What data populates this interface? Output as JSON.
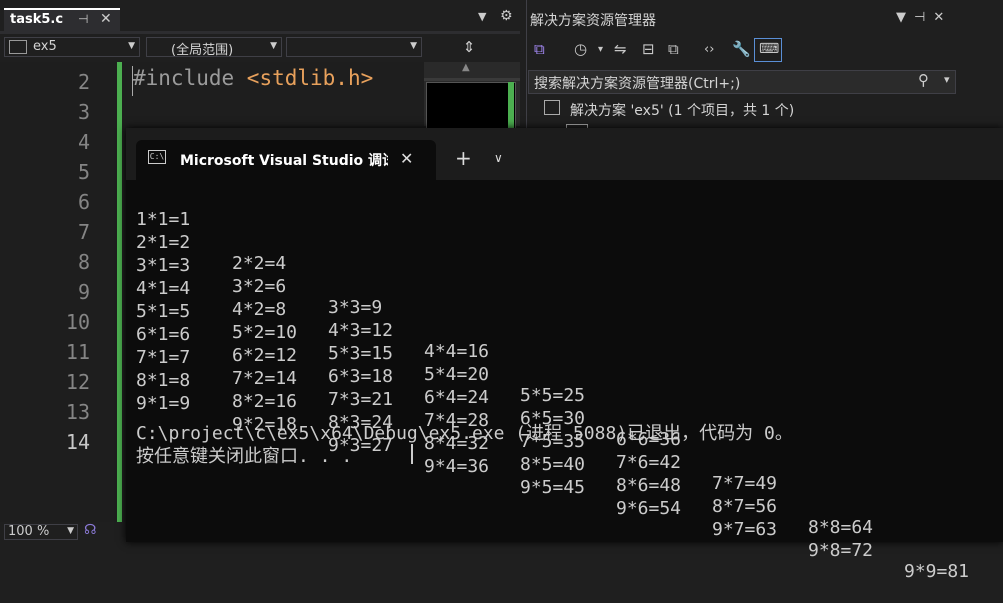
{
  "editor": {
    "tab_label": "task5.c",
    "tab_pin": "⊣",
    "tab_close": "✕",
    "tab_dropdown": "▼",
    "settings_icon": "⚙",
    "project_combo": "ex5",
    "scope_combo": "(全局范围)",
    "member_combo": "",
    "combo_arrow": "▼",
    "split_icon": "⇕",
    "line_numbers": [
      "2",
      "3",
      "4",
      "5",
      "6",
      "7",
      "8",
      "9",
      "10",
      "11",
      "12",
      "13",
      "14"
    ],
    "code_kw": "#include ",
    "code_str": "<stdlib.h>",
    "zoom": "100 %",
    "zoom_arrow": "▼",
    "copilot_icon": "☊"
  },
  "solution_explorer": {
    "title": "解决方案资源管理器",
    "controls": "▼⊣✕",
    "search_placeholder": "搜索解决方案资源管理器(Ctrl+;)",
    "search_icon": "⚲",
    "search_arrow": "▾",
    "solution_node": "解决方案 'ex5' (1 个项目，共 1 个)",
    "toolbar_icons": [
      "⧉",
      "◷",
      "▾",
      "⇋",
      "⊟",
      "⧉",
      "‹›",
      "🔧",
      "⌨"
    ]
  },
  "console": {
    "icon_text": "C:\\",
    "title": "Microsoft Visual Studio 调试控制台",
    "close": "✕",
    "new_tab": "+",
    "menu": "∨",
    "table": [
      [
        "1*1=1"
      ],
      [
        "2*1=2",
        "2*2=4"
      ],
      [
        "3*1=3",
        "3*2=6",
        "3*3=9"
      ],
      [
        "4*1=4",
        "4*2=8",
        "4*3=12",
        "4*4=16"
      ],
      [
        "5*1=5",
        "5*2=10",
        "5*3=15",
        "5*4=20",
        "5*5=25"
      ],
      [
        "6*1=6",
        "6*2=12",
        "6*3=18",
        "6*4=24",
        "6*5=30",
        "6*6=36"
      ],
      [
        "7*1=7",
        "7*2=14",
        "7*3=21",
        "7*4=28",
        "7*5=35",
        "7*6=42",
        "7*7=49"
      ],
      [
        "8*1=8",
        "8*2=16",
        "8*3=24",
        "8*4=32",
        "8*5=40",
        "8*6=48",
        "8*7=56",
        "8*8=64"
      ],
      [
        "9*1=9",
        "9*2=18",
        "9*3=27",
        "9*4=36",
        "9*5=45",
        "9*6=54",
        "9*7=63",
        "9*8=72",
        "9*9=81"
      ]
    ],
    "exit_message": "C:\\project\\c\\ex5\\x64\\Debug\\ex5.exe (进程 5088)已退出，代码为 0。",
    "close_prompt": "按任意键关闭此窗口. . ."
  }
}
